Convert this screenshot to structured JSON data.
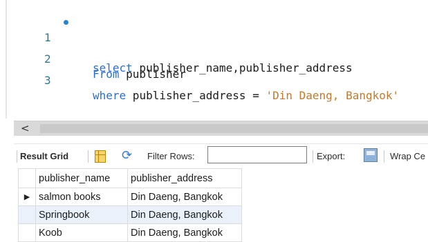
{
  "editor": {
    "lines": [
      {
        "num": "1",
        "kw1": "select",
        "rest1": " publisher_name,publisher_address",
        "kw2": "",
        "rest2": "",
        "str": ""
      },
      {
        "num": "2",
        "kw1": "From",
        "rest1": " publisher",
        "kw2": "",
        "rest2": "",
        "str": ""
      },
      {
        "num": "3",
        "kw1": "where",
        "rest1": " publisher_address = ",
        "kw2": "",
        "rest2": "",
        "str": "'Din Daeng, Bangkok'"
      }
    ]
  },
  "scrollbar": {
    "left_arrow": "<"
  },
  "toolbar": {
    "result_grid": "Result Grid",
    "filter_rows": "Filter Rows:",
    "filter_value": "",
    "export": "Export:",
    "wrap": "Wrap Ce"
  },
  "grid": {
    "columns": [
      "publisher_name",
      "publisher_address"
    ],
    "rows": [
      {
        "publisher_name": "salmon books",
        "publisher_address": "Din Daeng, Bangkok"
      },
      {
        "publisher_name": "Springbook",
        "publisher_address": "Din Daeng, Bangkok"
      },
      {
        "publisher_name": "Koob",
        "publisher_address": "Din Daeng, Bangkok"
      }
    ],
    "current_row_marker": "▶"
  },
  "colors": {
    "keyword": "#2a6fcf",
    "string": "#c37a2b",
    "line_number": "#2c7a8d",
    "selected_row": "#eaf1fb"
  }
}
